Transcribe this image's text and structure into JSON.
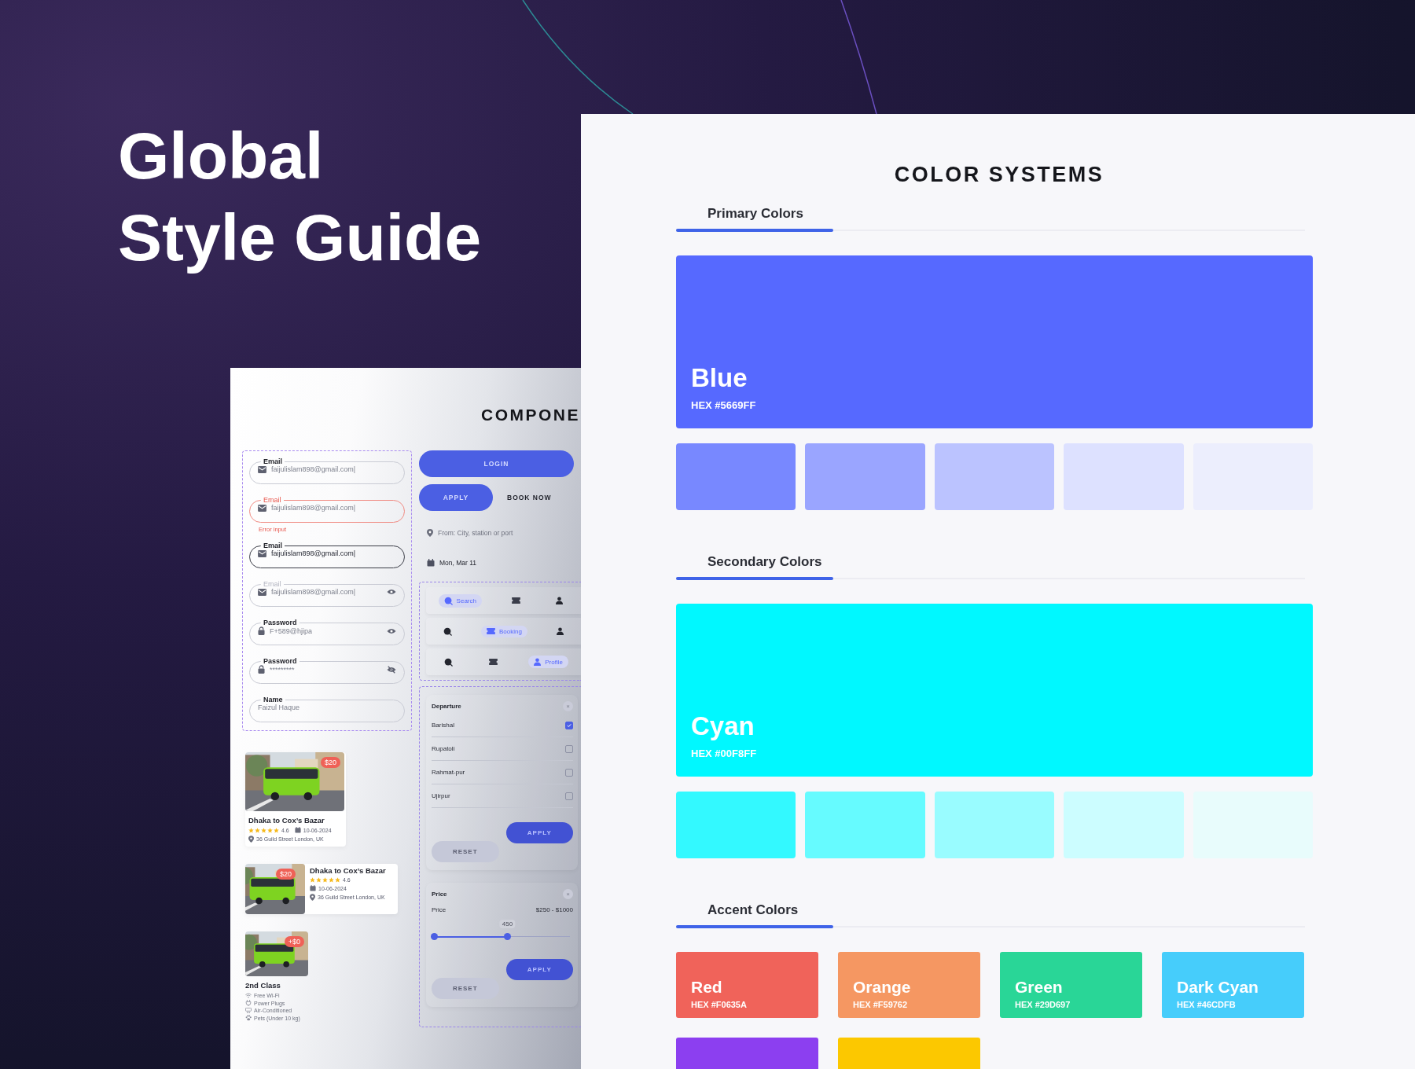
{
  "hero": {
    "title": "Global Style Guide"
  },
  "components": {
    "title": "COMPONE",
    "fields": [
      {
        "kind": "email",
        "label": "Email",
        "value": "faijulislam898@gmail.com|",
        "error": false,
        "focused": false,
        "disabled": false
      },
      {
        "kind": "email",
        "label": "Email",
        "value": "faijulislam898@gmail.com|",
        "error": true,
        "focused": false,
        "disabled": false,
        "error_text": "Error input"
      },
      {
        "kind": "email",
        "label": "Email",
        "value": "faijulislam898@gmail.com|",
        "error": false,
        "focused": true,
        "disabled": false
      },
      {
        "kind": "email-reveal",
        "label": "Email",
        "value": "faijulislam898@gmail.com|",
        "error": false,
        "focused": false,
        "disabled": true
      },
      {
        "kind": "password-shown",
        "label": "Password",
        "value": "F+589@hjipa",
        "error": false,
        "focused": false,
        "disabled": false
      },
      {
        "kind": "password-hidden",
        "label": "Password",
        "value": "*********",
        "error": false,
        "focused": false,
        "disabled": false
      },
      {
        "kind": "name",
        "label": "Name",
        "value": "Faizul Haque",
        "error": false,
        "focused": false,
        "disabled": false
      }
    ],
    "buttons": [
      {
        "label": "LOGIN",
        "kind": "wide"
      },
      {
        "label": "APPLY",
        "kind": "filled"
      },
      {
        "label": "BOOK NOW",
        "kind": "text"
      }
    ],
    "from_field": {
      "placeholder": "From: City, station or port"
    },
    "date_field": {
      "value": "Mon, Mar 11"
    },
    "nav_bars": [
      {
        "items": [
          {
            "kind": "search",
            "label": "Search",
            "selected": true
          },
          {
            "kind": "booking",
            "selected": false
          },
          {
            "kind": "profile",
            "selected": false
          }
        ]
      },
      {
        "items": [
          {
            "kind": "search",
            "selected": false
          },
          {
            "kind": "booking",
            "label": "Booking",
            "selected": true
          },
          {
            "kind": "profile",
            "selected": false
          }
        ]
      },
      {
        "items": [
          {
            "kind": "search",
            "selected": false
          },
          {
            "kind": "booking",
            "selected": false
          },
          {
            "kind": "profile",
            "label": "Profile",
            "selected": true
          }
        ]
      }
    ],
    "filters": [
      {
        "kind": "checklist",
        "title": "Departure",
        "close": "×",
        "options": [
          {
            "label": "Barishal",
            "checked": true
          },
          {
            "label": "Rupatoli",
            "checked": false
          },
          {
            "label": "Rahmat-pur",
            "checked": false
          },
          {
            "label": "Ujirpur",
            "checked": false
          }
        ],
        "buttons": [
          "RESET",
          "APPLY"
        ]
      },
      {
        "kind": "range",
        "title": "Price",
        "close": "×",
        "label": "Price",
        "range": "$250 - $1000",
        "tooltip": "450",
        "level": 0.54,
        "buttons": [
          "RESET",
          "APPLY"
        ]
      }
    ],
    "cards": [
      {
        "kind": "vertical",
        "badge": "$20",
        "title": "Dhaka to Cox’s Bazar",
        "stars": 5,
        "rating": "4.6",
        "date": "10-06-2024",
        "address": "36 Guild Street London, UK"
      },
      {
        "kind": "horizontal",
        "badge": "$20",
        "title": "Dhaka to Cox’s Bazar",
        "stars": 5,
        "rating": "4.6",
        "date": "10-06-2024",
        "address": "36 Guild Street London, UK"
      },
      {
        "kind": "amenities",
        "badge": "+$0",
        "title": "2nd Class",
        "amenities": [
          {
            "kind": "wifi",
            "label": "Free Wi-Fi"
          },
          {
            "kind": "plug",
            "label": "Power Plugs"
          },
          {
            "kind": "ac",
            "label": "Air-Conditioned"
          },
          {
            "kind": "paw",
            "label": "Pets (Under 10 kg)"
          }
        ]
      }
    ]
  },
  "colors": {
    "title": "COLOR SYSTEMS",
    "sections": [
      {
        "kind": "palette",
        "title": "Primary Colors",
        "main": {
          "name": "Blue",
          "hex": "HEX #5669FF",
          "color": "#5669ff"
        },
        "shades": [
          {
            "color": "#7888ff"
          },
          {
            "color": "#9aa5ff"
          },
          {
            "color": "#bbc3ff"
          },
          {
            "color": "#dde1ff"
          },
          {
            "color": "#eceefd"
          }
        ]
      },
      {
        "kind": "palette",
        "title": "Secondary Colors",
        "main": {
          "name": "Cyan",
          "hex": "HEX #00F8FF",
          "color": "#00f8ff"
        },
        "shades": [
          {
            "color": "#33f9ff"
          },
          {
            "color": "#66fbff"
          },
          {
            "color": "#99fcff"
          },
          {
            "color": "#ccfdff"
          },
          {
            "color": "#e8fcfc"
          }
        ]
      },
      {
        "kind": "accents",
        "title": "Accent Colors",
        "swatches": [
          {
            "name": "Red",
            "hex": "HEX #F0635A",
            "color": "#f0635a"
          },
          {
            "name": "Orange",
            "hex": "HEX #F59762",
            "color": "#f59762"
          },
          {
            "name": "Green",
            "hex": "HEX #29D697",
            "color": "#29d697"
          },
          {
            "name": "Dark Cyan",
            "hex": "HEX #46CDFB",
            "color": "#46cdfb"
          },
          {
            "color": "#8c3ff0"
          },
          {
            "color": "#fcc800"
          }
        ]
      }
    ]
  }
}
